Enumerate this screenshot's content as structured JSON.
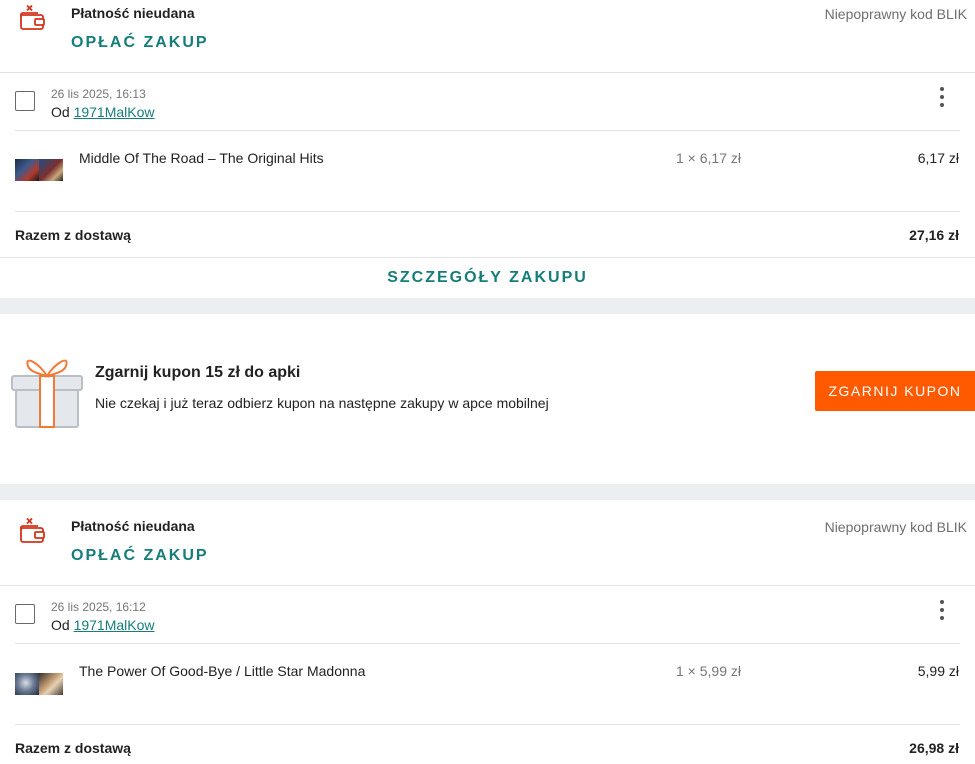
{
  "orders": [
    {
      "status_title": "Płatność nieudana",
      "pay_label": "OPŁAĆ ZAKUP",
      "status_reason": "Niepoprawny kod BLIK",
      "date": "26 lis 2025, 16:13",
      "seller_prefix": "Od",
      "seller_name": "1971MalKow",
      "item_title": "Middle Of The Road – The Original Hits",
      "qty": "1 × 6,17 zł",
      "price": "6,17 zł",
      "total_label": "Razem z dostawą",
      "total_value": "27,16 zł",
      "details_label": "SZCZEGÓŁY ZAKUPU"
    },
    {
      "status_title": "Płatność nieudana",
      "pay_label": "OPŁAĆ ZAKUP",
      "status_reason": "Niepoprawny kod BLIK",
      "date": "26 lis 2025, 16:12",
      "seller_prefix": "Od",
      "seller_name": "1971MalKow",
      "item_title": "The Power Of Good-Bye / Little Star Madonna",
      "qty": "1 × 5,99 zł",
      "price": "5,99 zł",
      "total_label": "Razem z dostawą",
      "total_value": "26,98 zł"
    }
  ],
  "promo": {
    "title": "Zgarnij kupon 15 zł do apki",
    "description": "Nie czekaj i już teraz odbierz kupon na następne zakupy w apce mobilnej",
    "button_label": "ZGARNIJ KUPON"
  },
  "icons": {
    "wallet": "wallet-error-icon",
    "gift": "gift-icon",
    "kebab": "more-vertical-icon"
  },
  "colors": {
    "accent_teal": "#167d7a",
    "brand_orange": "#ff5a00",
    "error_red": "#d4331c",
    "separator": "#eceff2"
  }
}
